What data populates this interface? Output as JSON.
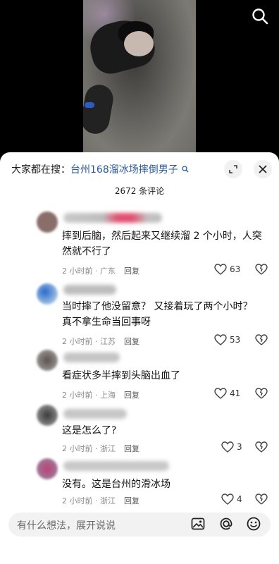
{
  "video": {
    "search_icon": "search-icon"
  },
  "sheet": {
    "hot_search_prefix": "大家都在搜：",
    "hot_search_keyword": "台州168溜冰场摔倒男子",
    "hot_search_icon": "search-small-icon",
    "expand_icon": "expand-icon",
    "close_icon": "close-icon",
    "comment_count": "2672 条评论"
  },
  "comments": [
    {
      "text_line1": "摔到后脑，然后起来又继续溜 2 个小时，人突",
      "text_line2": "然就不行了",
      "time": "2 小时前",
      "location": "广东",
      "reply_label": "回复",
      "likes": "63",
      "avatar_color": "#8a6e6a",
      "name_color": "#e15070"
    },
    {
      "text_line1": "当时摔了他没留意？ 又接着玩了两个小时？",
      "text_line2": "真不拿生命当回事呀",
      "time": "2 小时前",
      "location": "江苏",
      "reply_label": "回复",
      "likes": "53",
      "avatar_color": "#4a7ab0",
      "name_color": "#9aa0a6"
    },
    {
      "text_line1": "看症状多半摔到头脑出血了",
      "text_line2": "",
      "time": "2 小时前",
      "location": "上海",
      "reply_label": "回复",
      "likes": "41",
      "avatar_color": "#6a6360",
      "name_color": "#a7a9ab"
    },
    {
      "text_line1": "这是怎么了?",
      "text_line2": "",
      "time": "2 小时前",
      "location": "浙江",
      "reply_label": "回复",
      "likes": "3",
      "avatar_color": "#4a4a4a",
      "name_color": "#a0a0a0"
    },
    {
      "text_line1": "没有。这是台州的滑冰场",
      "text_line2": "",
      "time": "2 小时前",
      "location": "浙江",
      "reply_label": "回复",
      "likes": "4",
      "avatar_color": "#b04a78",
      "name_color": "#b0b0b0"
    }
  ],
  "bottom_bar": {
    "placeholder": "有什么想法，展开说说",
    "image_icon": "image-icon",
    "mention_icon": "at-mention-icon",
    "emoji_icon": "emoji-icon"
  }
}
